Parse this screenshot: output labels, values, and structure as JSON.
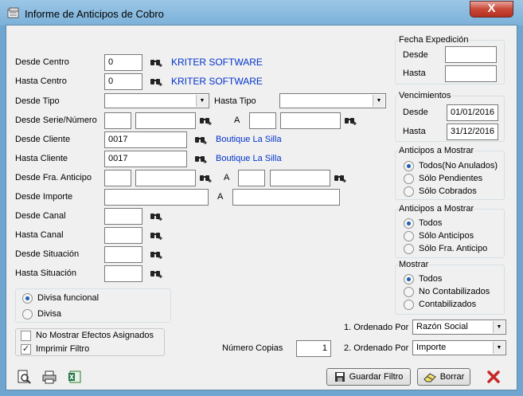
{
  "window": {
    "title": "Informe de Anticipos de Cobro",
    "close": "X"
  },
  "filters": {
    "desde_centro": {
      "label": "Desde Centro",
      "value": "0",
      "link": "KRITER SOFTWARE"
    },
    "hasta_centro": {
      "label": "Hasta Centro",
      "value": "0",
      "link": "KRITER SOFTWARE"
    },
    "desde_tipo": {
      "label": "Desde Tipo",
      "value": ""
    },
    "hasta_tipo": {
      "label": "Hasta Tipo",
      "value": ""
    },
    "desde_serie": {
      "label": "Desde Serie/Número",
      "sep": "A"
    },
    "desde_cliente": {
      "label": "Desde Cliente",
      "value": "0017",
      "link": "Boutique La Silla"
    },
    "hasta_cliente": {
      "label": "Hasta Cliente",
      "value": "0017",
      "link": "Boutique La Silla"
    },
    "desde_fra_anticipo": {
      "label": "Desde Fra. Anticipo",
      "sep": "A"
    },
    "desde_importe": {
      "label": "Desde Importe",
      "sep": "A"
    },
    "desde_canal": {
      "label": "Desde Canal"
    },
    "hasta_canal": {
      "label": "Hasta Canal"
    },
    "desde_situacion": {
      "label": "Desde Situación"
    },
    "hasta_situacion": {
      "label": "Hasta Situación"
    }
  },
  "divisa": {
    "options": [
      "Divisa funcional",
      "Divisa"
    ],
    "selected": 0
  },
  "checks": {
    "no_mostrar": {
      "label": "No Mostrar Efectos Asignados",
      "checked": false
    },
    "imprimir": {
      "label": "Imprimir Filtro",
      "checked": true
    }
  },
  "fecha_exp": {
    "title": "Fecha Expedición",
    "desde": "Desde",
    "hasta": "Hasta"
  },
  "vencimientos": {
    "title": "Vencimientos",
    "desde": "Desde",
    "hasta": "Hasta",
    "desde_value": "01/01/2016",
    "hasta_value": "31/12/2016"
  },
  "group1": {
    "title": "Anticipos a Mostrar",
    "options": [
      "Todos(No Anulados)",
      "Sólo Pendientes",
      "Sólo Cobrados"
    ],
    "selected": 0
  },
  "group2": {
    "title": "Anticipos a Mostrar",
    "options": [
      "Todos",
      "Sólo Anticipos",
      "Sólo Fra. Anticipo"
    ],
    "selected": 0
  },
  "group3": {
    "title": "Mostrar",
    "options": [
      "Todos",
      "No Contabilizados",
      "Contabilizados"
    ],
    "selected": 0
  },
  "order": {
    "label1": "1. Ordenado Por",
    "value1": "Razón Social",
    "label2": "2. Ordenado Por",
    "value2": "Importe"
  },
  "copias": {
    "label": "Número Copias",
    "value": "1"
  },
  "buttons": {
    "guardar": "Guardar Filtro",
    "borrar": "Borrar"
  }
}
